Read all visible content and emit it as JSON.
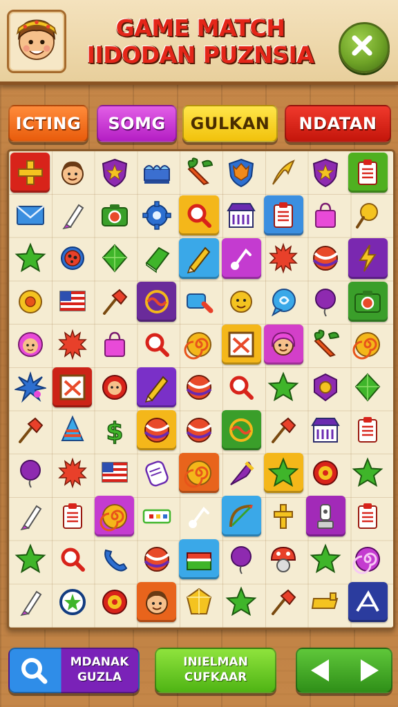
{
  "header": {
    "title_line1": "GAME MATCH",
    "title_line2": "IIDODAN PUZNSIA"
  },
  "tabs": [
    {
      "label": "ICTING",
      "color": "#f47320"
    },
    {
      "label": "SOMG",
      "color": "#c43bd0"
    },
    {
      "label": "GULKAN",
      "color": "#f6d21b"
    },
    {
      "label": "NDATAN",
      "color": "#d8231a"
    }
  ],
  "board": {
    "rows": 11,
    "cols": 9,
    "tiles": [
      [
        "plus",
        "face-boy",
        "shield-star",
        "bridge",
        "carrot",
        "shield-fox",
        "arrow-curve",
        "shield-star",
        "clipboard"
      ],
      [
        "envelope",
        "marker",
        "camera",
        "gear",
        "magnifier",
        "shop",
        "clipboard",
        "bag",
        "lollipop"
      ],
      [
        "star",
        "ladybug",
        "gem",
        "book",
        "pencil",
        "music",
        "sunburst",
        "ball",
        "bolt"
      ],
      [
        "gear-flower",
        "flag-us",
        "pin",
        "knot",
        "tag",
        "face-yellow",
        "speech",
        "balloon",
        "camera"
      ],
      [
        "face-pink",
        "sunburst",
        "bag",
        "magnifier",
        "swirl",
        "frame-x",
        "face-girl",
        "carrot",
        "swirl"
      ],
      [
        "splash",
        "frame-x",
        "face-badge",
        "pencil",
        "ball",
        "magnifier",
        "star",
        "badge",
        "gem"
      ],
      [
        "pin",
        "cone",
        "dollar",
        "ball",
        "ball",
        "knot",
        "pin",
        "shop",
        "clipboard"
      ],
      [
        "balloon",
        "sunburst",
        "flag-us",
        "scroll",
        "swirl",
        "feather",
        "star",
        "target",
        "star"
      ],
      [
        "marker",
        "clipboard",
        "swirl",
        "ruler",
        "music",
        "bow",
        "cross",
        "trophy",
        "clipboard"
      ],
      [
        "star",
        "magnifier",
        "phone",
        "ball",
        "cake",
        "balloon",
        "mushroom",
        "star",
        "candy"
      ],
      [
        "marker",
        "ring",
        "target",
        "face-boy",
        "crystal",
        "star",
        "pin",
        "gold",
        "logo"
      ]
    ],
    "tinted": [
      {
        "row": 0,
        "col": 0,
        "color": "#d8231a"
      },
      {
        "row": 0,
        "col": 8,
        "color": "#4fb020"
      },
      {
        "row": 1,
        "col": 4,
        "color": "#f4b71a"
      },
      {
        "row": 1,
        "col": 6,
        "color": "#3b8fe0"
      },
      {
        "row": 2,
        "col": 4,
        "color": "#3aa8e8"
      },
      {
        "row": 2,
        "col": 5,
        "color": "#c43bd0"
      },
      {
        "row": 2,
        "col": 8,
        "color": "#7a28b0"
      },
      {
        "row": 3,
        "col": 3,
        "color": "#6a2b9a"
      },
      {
        "row": 3,
        "col": 8,
        "color": "#3a9e2a"
      },
      {
        "row": 4,
        "col": 5,
        "color": "#f4b71a"
      },
      {
        "row": 4,
        "col": 6,
        "color": "#d33fc9"
      },
      {
        "row": 5,
        "col": 1,
        "color": "#cc2317"
      },
      {
        "row": 5,
        "col": 3,
        "color": "#7a30c8"
      },
      {
        "row": 6,
        "col": 3,
        "color": "#f4b71a"
      },
      {
        "row": 6,
        "col": 5,
        "color": "#3a9e2a"
      },
      {
        "row": 7,
        "col": 4,
        "color": "#e8641c"
      },
      {
        "row": 7,
        "col": 6,
        "color": "#f4b71a"
      },
      {
        "row": 8,
        "col": 2,
        "color": "#c43bd0"
      },
      {
        "row": 8,
        "col": 5,
        "color": "#3aa8e8"
      },
      {
        "row": 8,
        "col": 7,
        "color": "#a22ab8"
      },
      {
        "row": 9,
        "col": 4,
        "color": "#3aa8e8"
      },
      {
        "row": 10,
        "col": 3,
        "color": "#e8641c"
      },
      {
        "row": 10,
        "col": 8,
        "color": "#2b3c9e"
      }
    ]
  },
  "bottom": {
    "search_label_line1": "MDANAK",
    "search_label_line2": "GUZLA",
    "green_label_line1": "INIELMAN",
    "green_label_line2": "CUFKAAR"
  }
}
